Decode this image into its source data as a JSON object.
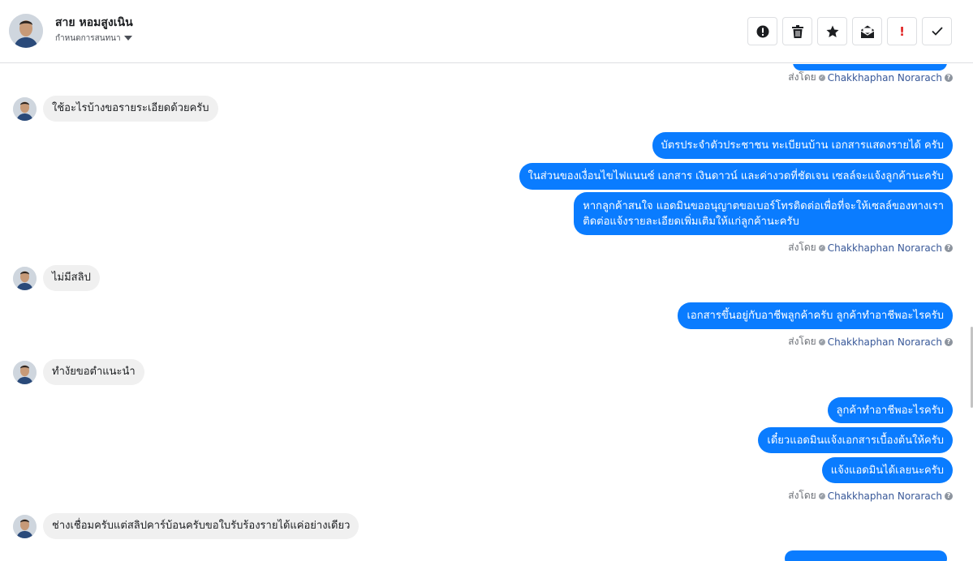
{
  "header": {
    "contact_name": "สาย หอมสูงเนิน",
    "subtitle": "กำหนดการสนทนา",
    "toolbar": [
      {
        "name": "alert-button",
        "icon": "exclamation-circle-icon"
      },
      {
        "name": "delete-button",
        "icon": "trash-icon"
      },
      {
        "name": "star-button",
        "icon": "star-icon"
      },
      {
        "name": "mark-unread-button",
        "icon": "envelope-icon"
      },
      {
        "name": "important-button",
        "icon": "exclamation-icon",
        "glyph": "!",
        "color": "#e02020"
      },
      {
        "name": "done-button",
        "icon": "checkmark-icon"
      }
    ]
  },
  "messages": {
    "sent_by_label": "ส่งโดย",
    "agent_name": "Chakkhaphan Norarach",
    "in_1": "ใช้อะไรบ้างขอรายระเอียดด้วยครับ",
    "out_1a": "บัตรประจำตัวประชาชน ทะเบียนบ้าน เอกสารแสดงรายได้ ครับ",
    "out_1b": "ในส่วนของเงื่อนไขไฟแนนซ์ เอกสาร เงินดาวน์ และค่างวดที่ชัดเจน เซลล์จะแจ้งลูกค้านะครับ",
    "out_1c_line1": "หากลูกค้าสนใจ แอดมินขออนุญาตขอเบอร์โทรติดต่อเพื่อที่จะให้เซลล์ของทางเรา",
    "out_1c_line2": "ติดต่อแจ้งรายละเอียดเพิ่มเติมให้แก่ลูกค้านะครับ",
    "in_2": "ไม่มีสลิป",
    "out_2": "เอกสารขึ้นอยู่กับอาชีพลูกค้าครับ ลูกค้าทำอาชีพอะไรครับ",
    "in_3": "ทำงัยขอตำแนะนำ",
    "out_3a": "ลูกค้าทำอาชีพอะไรครับ",
    "out_3b": "เดี๋ยวแอดมินแจ้งเอกสารเบื้องต้นให้ครับ",
    "out_3c": "แจ้งแอดมินได้เลยนะครับ",
    "in_4": "ช่างเชื่อมครับแต่สลิปคาร์บ้อนครับขอใบรับร้องรายได้แค่อย่างเดียว"
  },
  "colors": {
    "outgoing_bubble": "#0a7cff",
    "incoming_bubble": "#f0f0f0",
    "agent_link": "#385898"
  }
}
